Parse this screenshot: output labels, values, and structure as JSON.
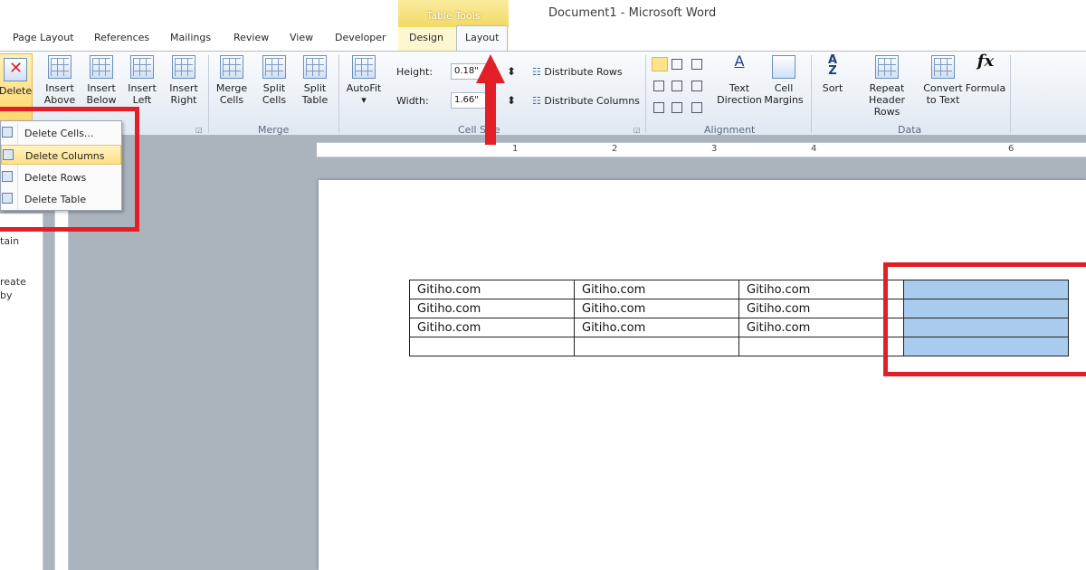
{
  "window": {
    "title": "Document1 - Microsoft Word",
    "context_tab_group": "Table Tools"
  },
  "tabs": [
    "Page Layout",
    "References",
    "Mailings",
    "Review",
    "View",
    "Developer",
    "Design",
    "Layout"
  ],
  "ribbon": {
    "rows_columns": {
      "delete_label": "Delete",
      "insert_above": [
        "Insert",
        "Above"
      ],
      "insert_below": [
        "Insert",
        "Below"
      ],
      "insert_left": [
        "Insert",
        "Left"
      ],
      "insert_right": [
        "Insert",
        "Right"
      ]
    },
    "merge": {
      "merge_cells": [
        "Merge",
        "Cells"
      ],
      "split_cells": [
        "Split",
        "Cells"
      ],
      "split_table": [
        "Split",
        "Table"
      ],
      "label": "Merge"
    },
    "cell_size": {
      "autofit": "AutoFit",
      "height_label": "Height:",
      "height_value": "0.18\"",
      "width_label": "Width:",
      "width_value": "1.66\"",
      "distribute_rows": "Distribute Rows",
      "distribute_columns": "Distribute Columns",
      "label": "Cell Size"
    },
    "alignment": {
      "text_direction": [
        "Text",
        "Direction"
      ],
      "cell_margins": [
        "Cell",
        "Margins"
      ],
      "label": "Alignment"
    },
    "data": {
      "sort": "Sort",
      "repeat_header": [
        "Repeat",
        "Header Rows"
      ],
      "convert": [
        "Convert",
        "to Text"
      ],
      "formula": "Formula",
      "fx": "fx",
      "label": "Data"
    }
  },
  "delete_menu": [
    "Delete Cells...",
    "Delete Columns",
    "Delete Rows",
    "Delete Table"
  ],
  "nav_pane_fragments": [
    "tain",
    "reate",
    "by"
  ],
  "ruler": [
    "1",
    "2",
    "3",
    "4",
    "6"
  ],
  "table": {
    "rows": [
      [
        "Gitiho.com",
        "Gitiho.com",
        "Gitiho.com",
        ""
      ],
      [
        "Gitiho.com",
        "Gitiho.com",
        "Gitiho.com",
        ""
      ],
      [
        "Gitiho.com",
        "Gitiho.com",
        "Gitiho.com",
        ""
      ],
      [
        "",
        "",
        "",
        ""
      ]
    ],
    "selected_column": 3
  },
  "colors": {
    "highlight_red": "#e21f26",
    "selection_blue": "#a8cbee",
    "menu_hover": "#ffe085"
  }
}
